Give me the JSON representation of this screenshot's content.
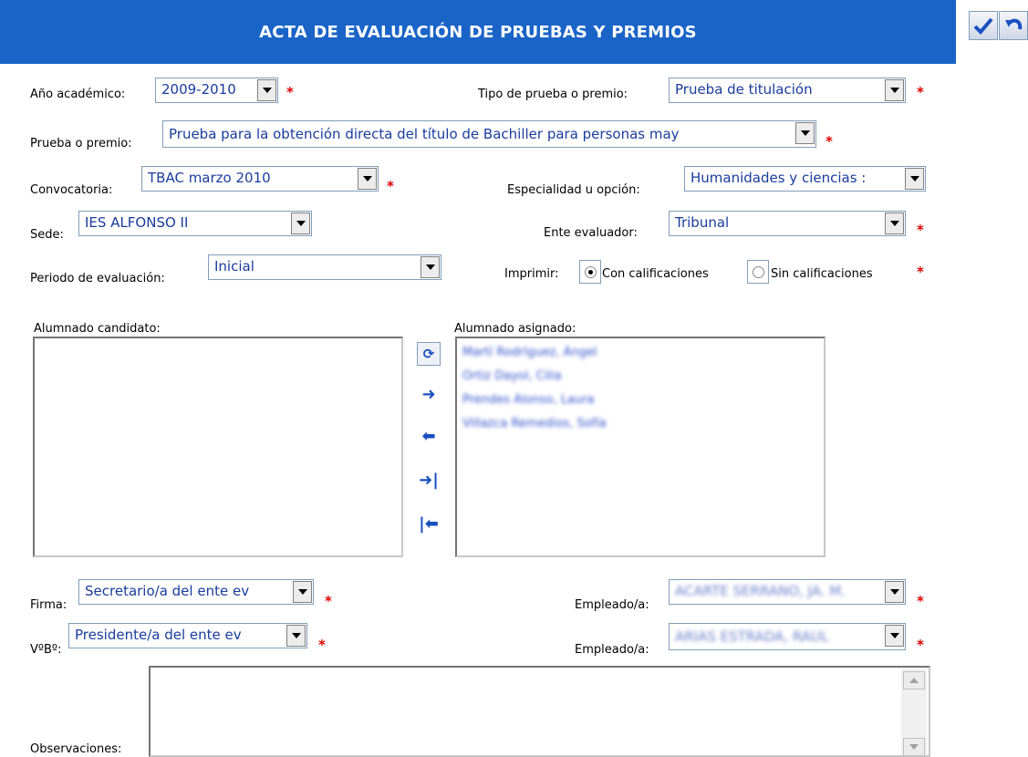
{
  "header": {
    "title": "ACTA DE EVALUACIÓN DE PRUEBAS Y PREMIOS"
  },
  "form": {
    "anio_label": "Año académico:",
    "anio_value": "2009-2010",
    "tipo_label": "Tipo de prueba o premio:",
    "tipo_value": "Prueba de titulación",
    "prueba_label": "Prueba o premio:",
    "prueba_value": "Prueba para la obtención directa del título de Bachiller para personas may",
    "convocatoria_label": "Convocatoria:",
    "convocatoria_value": "TBAC marzo 2010",
    "especialidad_label": "Especialidad u opción:",
    "especialidad_value": "Humanidades y ciencias :",
    "sede_label": "Sede:",
    "sede_value": "IES ALFONSO II",
    "ente_label": "Ente evaluador:",
    "ente_value": "Tribunal",
    "periodo_label": "Periodo de evaluación:",
    "periodo_value": "Inicial",
    "imprimir_label": "Imprimir:",
    "imprimir_con": "Con calificaciones",
    "imprimir_sin": "Sin calificaciones",
    "required_mark": "*"
  },
  "lists": {
    "candidato_label": "Alumnado candidato:",
    "asignado_label": "Alumnado asignado:",
    "asignado_items": [
      "Martí Rodríguez, Ángel",
      "Ortiz Dayol, Cilia",
      "Prendes Alonso, Laura",
      "Villazca Remedios, Sofía"
    ]
  },
  "transfer": {
    "refresh": "⟳",
    "add": "➜",
    "remove": "⬅",
    "add_all": "➜|",
    "remove_all": "|⬅"
  },
  "firma": {
    "firma_label": "Firma:",
    "firma_value": "Secretario/a del ente ev",
    "empleado1_label": "Empleado/a:",
    "empleado1_value": "ACARTE SERRANO, JA. M.",
    "vobo_label": "VºBº:",
    "vobo_value": "Presidente/a del ente ev",
    "empleado2_label": "Empleado/a:",
    "empleado2_value": "ARIAS ESTRADA, RAUL"
  },
  "observaciones_label": "Observaciones:",
  "colors": {
    "header_bg": "#1a64c8",
    "required": "#e00000",
    "value_text": "#1a3c9c"
  }
}
